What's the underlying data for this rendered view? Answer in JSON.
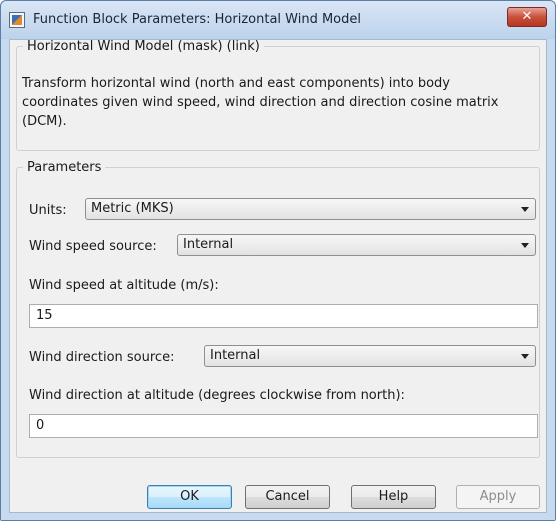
{
  "window": {
    "title": "Function Block Parameters: Horizontal Wind Model",
    "close_glyph": "✕",
    "icon": "matlab-block-icon"
  },
  "description": {
    "group_label": "Horizontal Wind Model (mask) (link)",
    "text": "Transform horizontal wind (north and east components) into body coordinates given wind speed, wind direction and direction cosine matrix (DCM)."
  },
  "parameters": {
    "group_label": "Parameters",
    "units_label": "Units:",
    "units_value": "Metric (MKS)",
    "speed_source_label": "Wind speed source:",
    "speed_source_value": "Internal",
    "speed_label": "Wind speed at altitude (m/s):",
    "speed_value": "15",
    "direction_source_label": "Wind direction source:",
    "direction_source_value": "Internal",
    "direction_label": "Wind direction at altitude (degrees clockwise from north):",
    "direction_value": "0"
  },
  "buttons": {
    "ok": "OK",
    "cancel": "Cancel",
    "help": "Help",
    "apply": "Apply"
  }
}
